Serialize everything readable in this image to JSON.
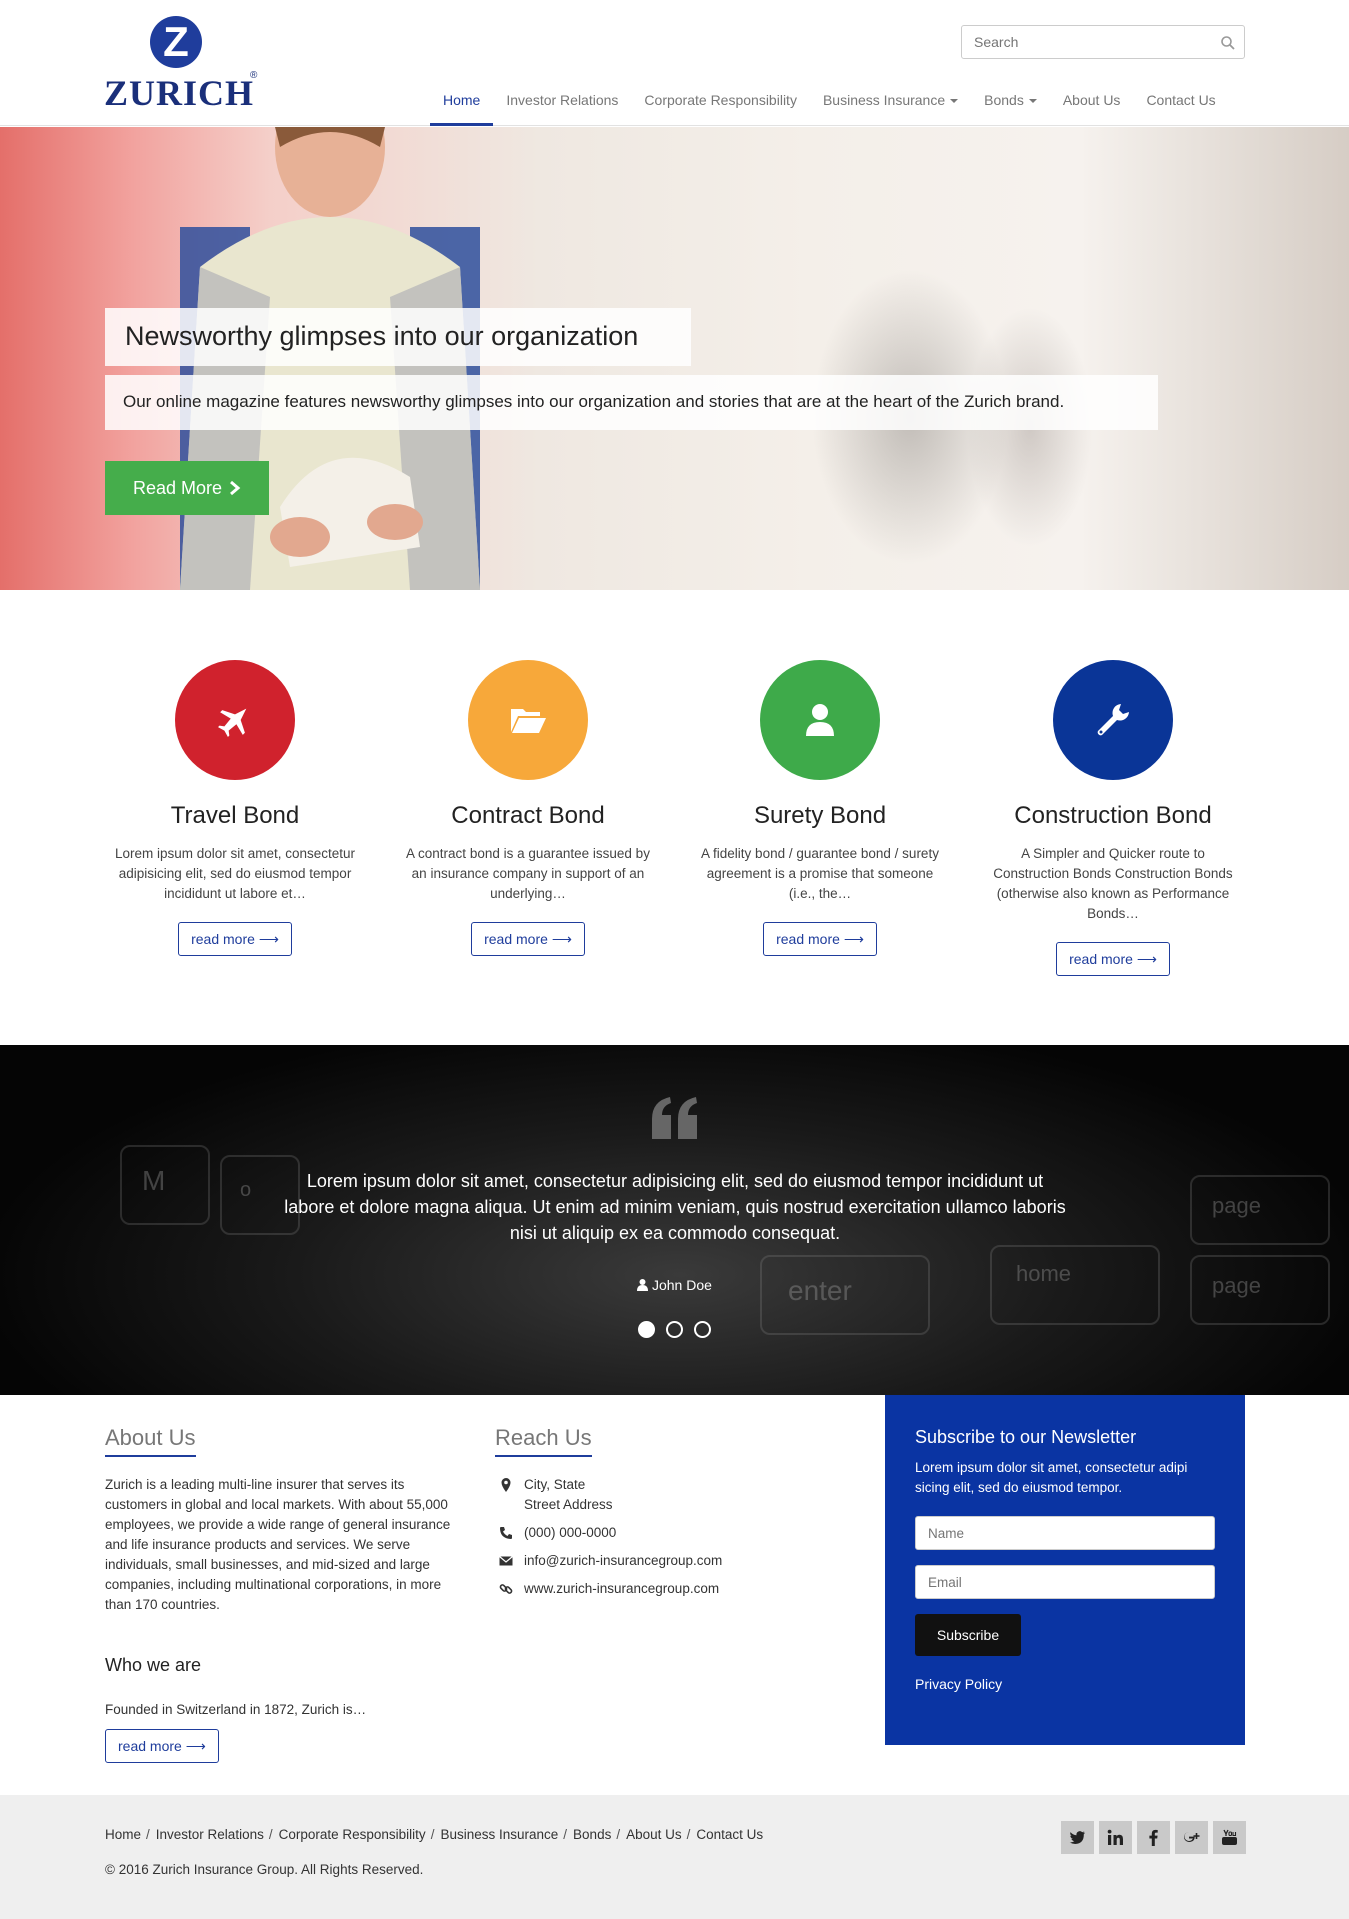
{
  "header": {
    "logo_text": "ZURICH",
    "logo_mark": "Z",
    "logo_reg": "®",
    "search": {
      "placeholder": "Search",
      "icon": "search-icon"
    },
    "nav": [
      {
        "label": "Home",
        "active": true
      },
      {
        "label": "Investor Relations"
      },
      {
        "label": "Corporate Responsibility"
      },
      {
        "label": "Business Insurance",
        "dropdown": true
      },
      {
        "label": "Bonds",
        "dropdown": true
      },
      {
        "label": "About Us"
      },
      {
        "label": "Contact Us"
      }
    ]
  },
  "hero": {
    "title": "Newsworthy glimpses into our organization",
    "subtitle": "Our online magazine features newsworthy glimpses into our organization and stories that are at the heart of the Zurich brand.",
    "button_label": "Read More",
    "button_color": "#45ad4b"
  },
  "features": [
    {
      "title": "Travel Bond",
      "text": "Lorem ipsum dolor sit amet, consectetur adipisicing elit, sed do eiusmod tempor incididunt ut labore et…",
      "button": "read more",
      "icon": "plane-icon",
      "color": "#d0222d"
    },
    {
      "title": "Contract Bond",
      "text": "A contract bond is a guarantee issued by an insurance company in support of an underlying…",
      "button": "read more",
      "icon": "folder-open-icon",
      "color": "#f7a83a"
    },
    {
      "title": "Surety Bond",
      "text": "A fidelity bond / guarantee bond / surety agreement is a promise that someone (i.e., the…",
      "button": "read more",
      "icon": "user-icon",
      "color": "#3eaa4a"
    },
    {
      "title": "Construction Bond",
      "text": "A Simpler and Quicker route to Construction Bonds Construction Bonds (otherwise also known as Performance Bonds…",
      "button": "read more",
      "icon": "wrench-icon",
      "color": "#0a3597"
    }
  ],
  "testimonial": {
    "quote": "Lorem ipsum dolor sit amet, consectetur adipisicing elit, sed do eiusmod tempor incididunt ut labore et dolore magna aliqua. Ut enim ad minim veniam, quis nostrud exercitation ullamco laboris nisi ut aliquip ex ea commodo consequat.",
    "author": "John Doe",
    "slides": 3,
    "active_slide": 1,
    "background_keys": [
      "M",
      "o",
      "enter",
      "home",
      "page",
      "page"
    ]
  },
  "about": {
    "title": "About Us",
    "text": "Zurich is a leading multi-line insurer that serves its customers in global and local markets. With about 55,000 employees, we provide a wide range of general insurance and life insurance products and services. We serve individuals, small businesses, and mid-sized and large companies, including multinational corporations, in more than 170 countries.",
    "who_title": "Who we are",
    "who_text": "Founded in Switzerland in 1872, Zurich is…",
    "button": "read more"
  },
  "reach": {
    "title": "Reach Us",
    "address_line1": "City, State",
    "address_line2": "Street Address",
    "phone": "(000) 000-0000",
    "email": "info@zurich-insurancegroup.com",
    "website": "www.zurich-insurancegroup.com"
  },
  "newsletter": {
    "title": "Subscribe to our Newsletter",
    "text": "Lorem ipsum dolor sit amet, consectetur adipi sicing elit, sed do eiusmod tempor.",
    "name_placeholder": "Name",
    "email_placeholder": "Email",
    "button": "Subscribe",
    "privacy": "Privacy Policy",
    "background": "#0a34a3"
  },
  "footer": {
    "links": [
      "Home",
      "Investor Relations",
      "Corporate Responsibility",
      "Business Insurance",
      "Bonds",
      "About Us",
      "Contact Us"
    ],
    "separator": "/",
    "copyright": "© 2016 Zurich Insurance Group. All Rights Reserved.",
    "socials": [
      "twitter-icon",
      "linkedin-icon",
      "facebook-icon",
      "google-plus-icon",
      "youtube-icon"
    ]
  },
  "colors": {
    "brand": "#1f3d9c",
    "accent_green": "#45ad4b"
  }
}
